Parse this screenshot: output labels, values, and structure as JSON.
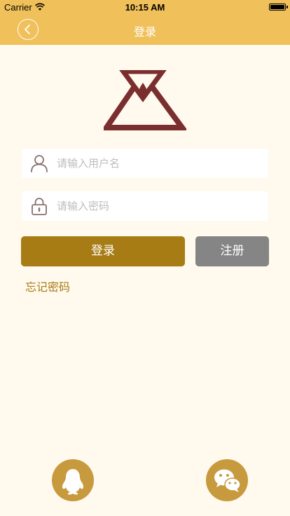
{
  "status_bar": {
    "carrier": "Carrier",
    "time": "10:15 AM"
  },
  "nav": {
    "title": "登录",
    "back_icon": "chevron-left-icon"
  },
  "login_form": {
    "username_placeholder": "请输入用户名",
    "password_placeholder": "请输入密码",
    "username_icon": "user-icon",
    "password_icon": "lock-icon"
  },
  "actions": {
    "login_label": "登录",
    "register_label": "注册",
    "forgot_label": "忘记密码"
  },
  "social": {
    "qq_icon": "qq-penguin-icon",
    "wechat_icon": "wechat-icon"
  },
  "colors": {
    "header": "#F0C05A",
    "background": "#FFF9EE",
    "login_button": "#A77C15",
    "register_button": "#858585",
    "forgot_text": "#A77C15",
    "logo": "#7A2E2E",
    "social_button": "#C89A3E"
  }
}
